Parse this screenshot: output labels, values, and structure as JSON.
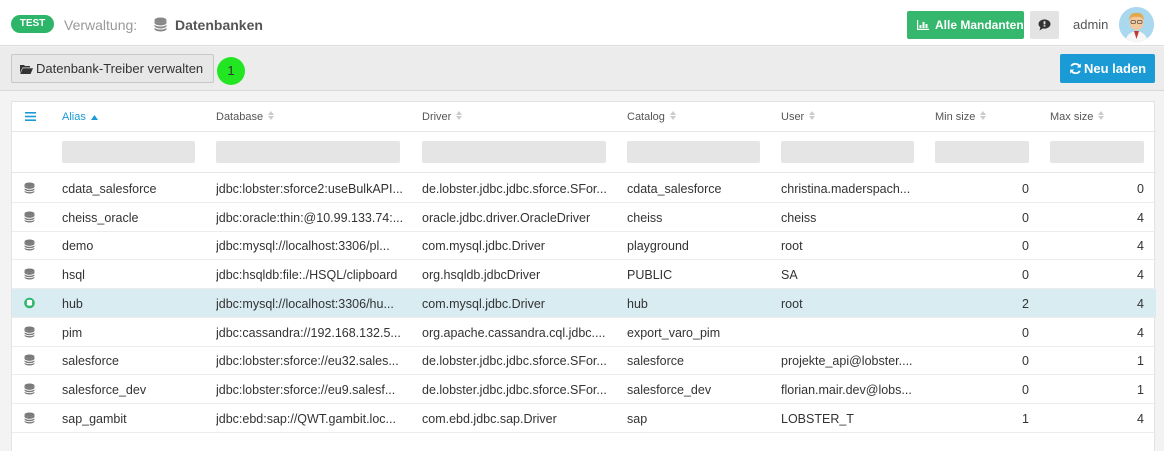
{
  "header": {
    "env_badge": "TEST",
    "breadcrumb_parent": "Verwaltung:",
    "breadcrumb_current": "Datenbanken",
    "mandanten_button": "Alle Mandanten",
    "user_name": "admin"
  },
  "toolbar": {
    "treiber_button": "Datenbank-Treiber verwalten",
    "count_badge": "1",
    "reload_button": "Neu laden"
  },
  "table": {
    "columns": [
      {
        "label": "Alias"
      },
      {
        "label": "Database"
      },
      {
        "label": "Driver"
      },
      {
        "label": "Catalog"
      },
      {
        "label": "User"
      },
      {
        "label": "Min size"
      },
      {
        "label": "Max size"
      }
    ],
    "rows": [
      {
        "alias": "cdata_salesforce",
        "database": "jdbc:lobster:sforce2:useBulkAPI...",
        "driver": "de.lobster.jdbc.jdbc.sforce.SFor...",
        "catalog": "cdata_salesforce",
        "user": "christina.maderspach...",
        "min": "0",
        "max": "0",
        "icon": "database-icon"
      },
      {
        "alias": "cheiss_oracle",
        "database": "jdbc:oracle:thin:@10.99.133.74:...",
        "driver": "oracle.jdbc.driver.OracleDriver",
        "catalog": "cheiss",
        "user": "cheiss",
        "min": "0",
        "max": "4",
        "icon": "database-icon"
      },
      {
        "alias": "demo",
        "database": "jdbc:mysql://localhost:3306/pl...",
        "driver": "com.mysql.jdbc.Driver",
        "catalog": "playground",
        "user": "root",
        "min": "0",
        "max": "4",
        "icon": "database-icon"
      },
      {
        "alias": "hsql",
        "database": "jdbc:hsqldb:file:./HSQL/clipboard",
        "driver": "org.hsqldb.jdbcDriver",
        "catalog": "PUBLIC",
        "user": "SA",
        "min": "0",
        "max": "4",
        "icon": "database-icon"
      },
      {
        "alias": "hub",
        "database": "jdbc:mysql://localhost:3306/hu...",
        "driver": "com.mysql.jdbc.Driver",
        "catalog": "hub",
        "user": "root",
        "min": "2",
        "max": "4",
        "icon": "active-connection-icon",
        "selected": true
      },
      {
        "alias": "pim",
        "database": "jdbc:cassandra://192.168.132.5...",
        "driver": "org.apache.cassandra.cql.jdbc....",
        "catalog": "export_varo_pim",
        "user": "",
        "min": "0",
        "max": "4",
        "icon": "database-icon"
      },
      {
        "alias": "salesforce",
        "database": "jdbc:lobster:sforce://eu32.sales...",
        "driver": "de.lobster.jdbc.jdbc.sforce.SFor...",
        "catalog": "salesforce",
        "user": "projekte_api@lobster....",
        "min": "0",
        "max": "1",
        "icon": "database-icon"
      },
      {
        "alias": "salesforce_dev",
        "database": "jdbc:lobster:sforce://eu9.salesf...",
        "driver": "de.lobster.jdbc.jdbc.sforce.SFor...",
        "catalog": "salesforce_dev",
        "user": "florian.mair.dev@lobs...",
        "min": "0",
        "max": "1",
        "icon": "database-icon"
      },
      {
        "alias": "sap_gambit",
        "database": "jdbc:ebd:sap://QWT.gambit.loc...",
        "driver": "com.ebd.jdbc.sap.Driver",
        "catalog": "sap",
        "user": "LOBSTER_T",
        "min": "1",
        "max": "4",
        "icon": "database-icon"
      }
    ]
  },
  "colors": {
    "accent": "#1a9bd5",
    "success": "#35b76e",
    "badge_green": "#22e622",
    "selected_row": "#d8ecf2"
  }
}
